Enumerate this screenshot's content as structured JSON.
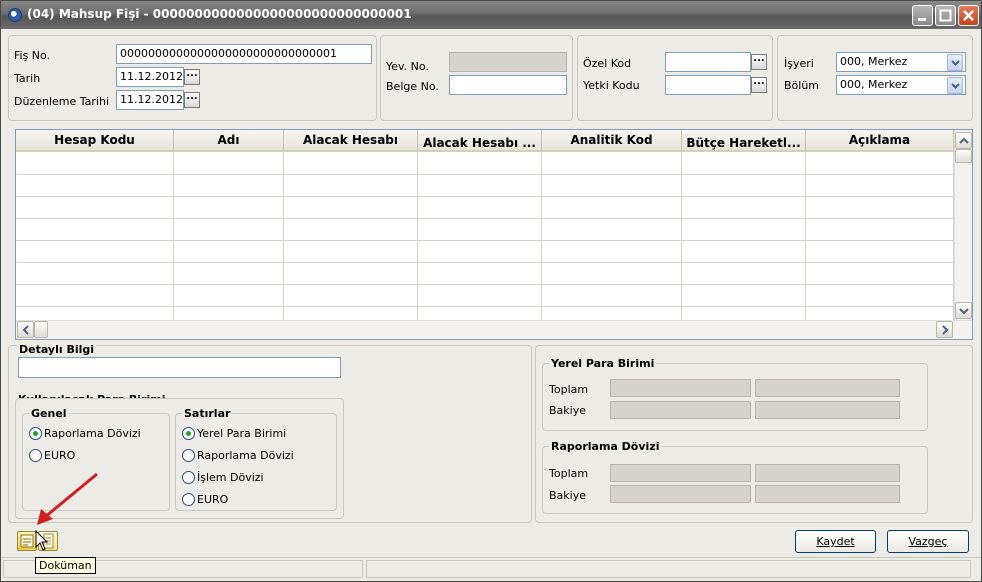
{
  "window": {
    "title": "(04) Mahsup Fişi - 0000000000000000000000000000001"
  },
  "header": {
    "fis_no_label": "Fiş No.",
    "fis_no_value": "0000000000000000000000000000001",
    "tarih_label": "Tarih",
    "tarih_value": "11.12.2012",
    "duzenleme_label": "Düzenleme Tarihi",
    "duzenleme_value": "11.12.2012",
    "yev_no_label": "Yev. No.",
    "yev_no_value": "",
    "belge_no_label": "Belge No.",
    "belge_no_value": "",
    "ozel_kod_label": "Özel Kod",
    "ozel_kod_value": "",
    "yetki_kodu_label": "Yetki Kodu",
    "yetki_kodu_value": "",
    "isyeri_label": "İşyeri",
    "isyeri_value": "000, Merkez",
    "bolum_label": "Bölüm",
    "bolum_value": "000, Merkez",
    "ellipsis": "..."
  },
  "grid": {
    "columns": [
      "Hesap Kodu",
      "Adı",
      "Alacak Hesabı",
      "Alacak Hesabı ...",
      "Analitik Kod",
      "Bütçe Hareketl...",
      "Açıklama"
    ],
    "rows": [
      [],
      [],
      [],
      [],
      [],
      [],
      []
    ]
  },
  "detail": {
    "label": "Detaylı Bilgi",
    "value": ""
  },
  "currency": {
    "title": "Kullanılacak Para Birimi",
    "genel_title": "Genel",
    "genel_options": [
      "Raporlama Dövizi",
      "EURO"
    ],
    "genel_selected": 0,
    "satirlar_title": "Satırlar",
    "satirlar_options": [
      "Yerel Para Birimi",
      "Raporlama Dövizi",
      "İşlem Dövizi",
      "EURO"
    ],
    "satirlar_selected": 0
  },
  "totals": {
    "yerel_title": "Yerel Para Birimi",
    "raporlama_title": "Raporlama Dövizi",
    "toplam_label": "Toplam",
    "bakiye_label": "Bakiye"
  },
  "buttons": {
    "kaydet": "Kaydet",
    "vazgec": "Vazgeç"
  },
  "tooltip": {
    "text": "Doküman"
  },
  "icons": [
    "window-app-icon",
    "minimize-icon",
    "maximize-icon",
    "close-icon",
    "ellipsis-icon",
    "chevron-down-icon",
    "document-icon",
    "list-icon",
    "mouse-cursor-icon",
    "red-arrow-annotation"
  ],
  "colors": {
    "titlebar": "#6b6b6b",
    "close": "#c2431f",
    "radio_dot": "#21a121",
    "arrow": "#d21f1f"
  }
}
